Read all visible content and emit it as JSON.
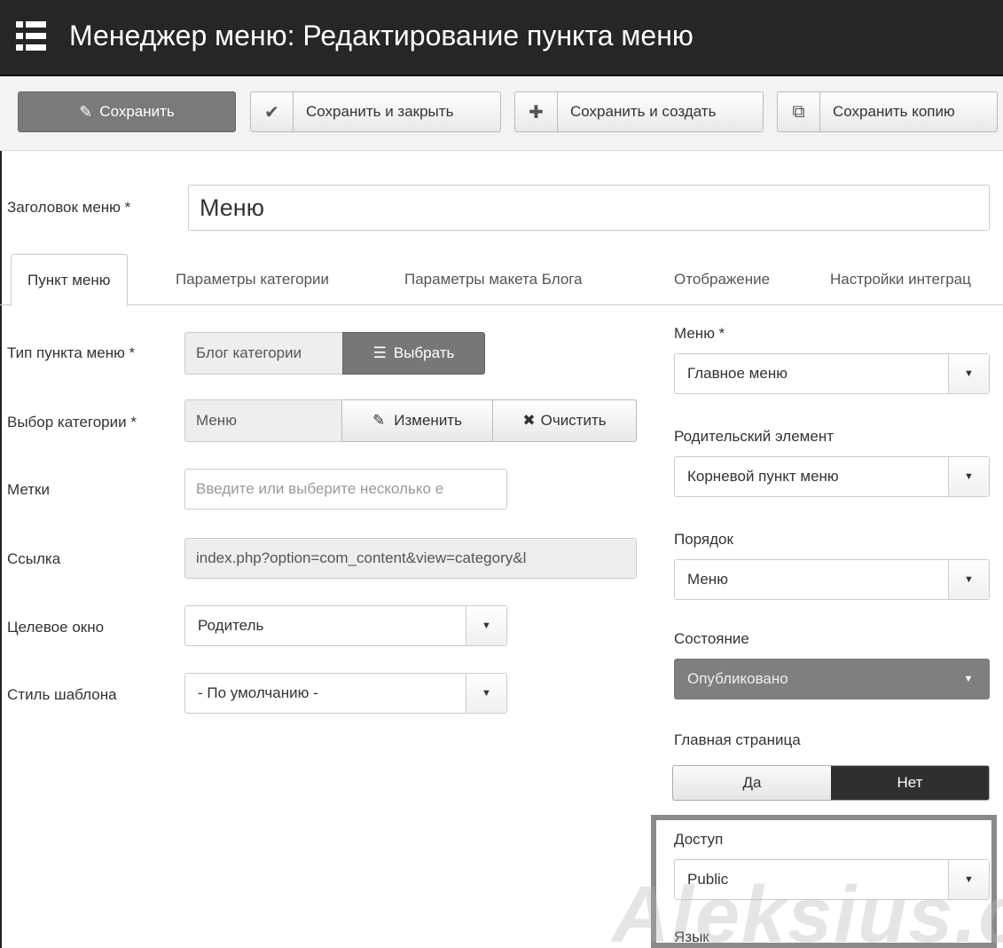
{
  "title": "Менеджер меню: Редактирование пункта меню",
  "toolbar": {
    "save": "Сохранить",
    "save_close": "Сохранить и закрыть",
    "save_new": "Сохранить и создать",
    "save_copy": "Сохранить копию"
  },
  "menu_title": {
    "label": "Заголовок меню *",
    "value": "Меню"
  },
  "tabs": [
    "Пункт меню",
    "Параметры категории",
    "Параметры макета Блога",
    "Отображение",
    "Настройки интеграц"
  ],
  "left": {
    "type": {
      "label": "Тип пункта меню *",
      "value": "Блог категории",
      "button": "Выбрать"
    },
    "category": {
      "label": "Выбор категории *",
      "value": "Меню",
      "edit": "Изменить",
      "clear": "Очистить"
    },
    "tags": {
      "label": "Метки",
      "placeholder": "Введите или выберите несколько е"
    },
    "link": {
      "label": "Ссылка",
      "value": "index.php?option=com_content&view=category&l"
    },
    "target": {
      "label": "Целевое окно",
      "value": "Родитель"
    },
    "template_style": {
      "label": "Стиль шаблона",
      "value": "- По умолчанию -"
    }
  },
  "right": {
    "menu": {
      "label": "Меню *",
      "value": "Главное меню"
    },
    "parent": {
      "label": "Родительский элемент",
      "value": "Корневой пункт меню"
    },
    "ordering": {
      "label": "Порядок",
      "value": "Меню"
    },
    "state": {
      "label": "Состояние",
      "value": "Опубликовано"
    },
    "home": {
      "label": "Главная страница",
      "yes": "Да",
      "no": "Нет"
    },
    "access": {
      "label": "Доступ",
      "value": "Public"
    },
    "language": {
      "label": "Язык"
    }
  },
  "watermark": "Aleksius.com"
}
